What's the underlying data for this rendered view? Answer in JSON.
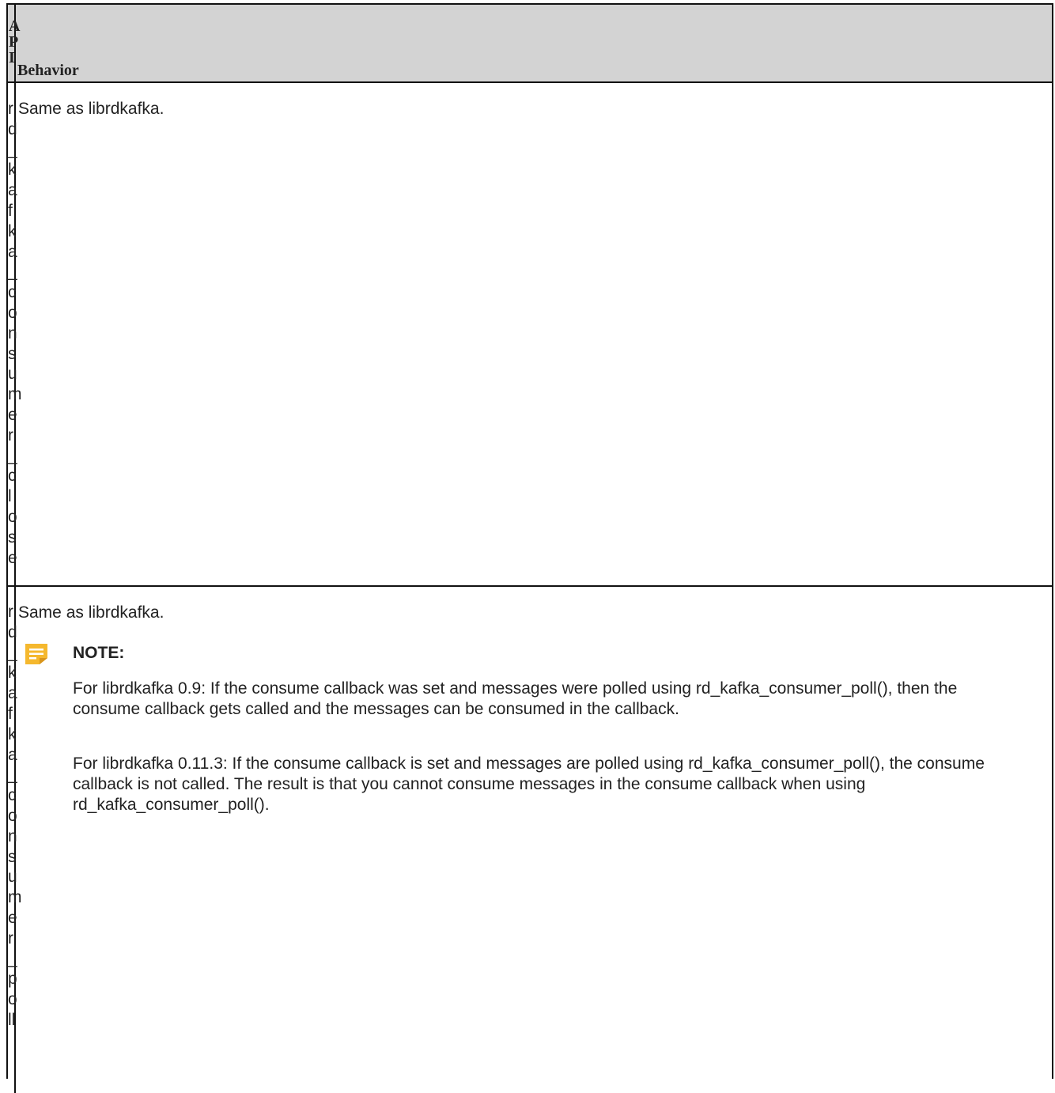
{
  "table": {
    "header": {
      "api": "API",
      "behavior": "Behavior"
    },
    "rows": [
      {
        "api": "rd_kafka_consumer_close",
        "behavior": "Same as librdkafka."
      },
      {
        "api": "rd_kafka_consumer_poll",
        "behavior": "Same as librdkafka.",
        "note": {
          "title": "NOTE:",
          "icon": "note-icon",
          "paragraphs": [
            "For librdkafka 0.9: If the consume callback was set and messages were polled using rd_kafka_consumer_poll(), then the consume callback gets called and the messages can be consumed in the callback.",
            "For librdkafka 0.11.3: If the consume callback is set and messages are polled using rd_kafka_consumer_poll(), the consume callback is not called. The result is that you cannot consume messages in the consume callback when using rd_kafka_consumer_poll()."
          ]
        }
      }
    ]
  },
  "colors": {
    "header_bg": "#d3d3d3",
    "note_icon": "#f5b82e"
  }
}
